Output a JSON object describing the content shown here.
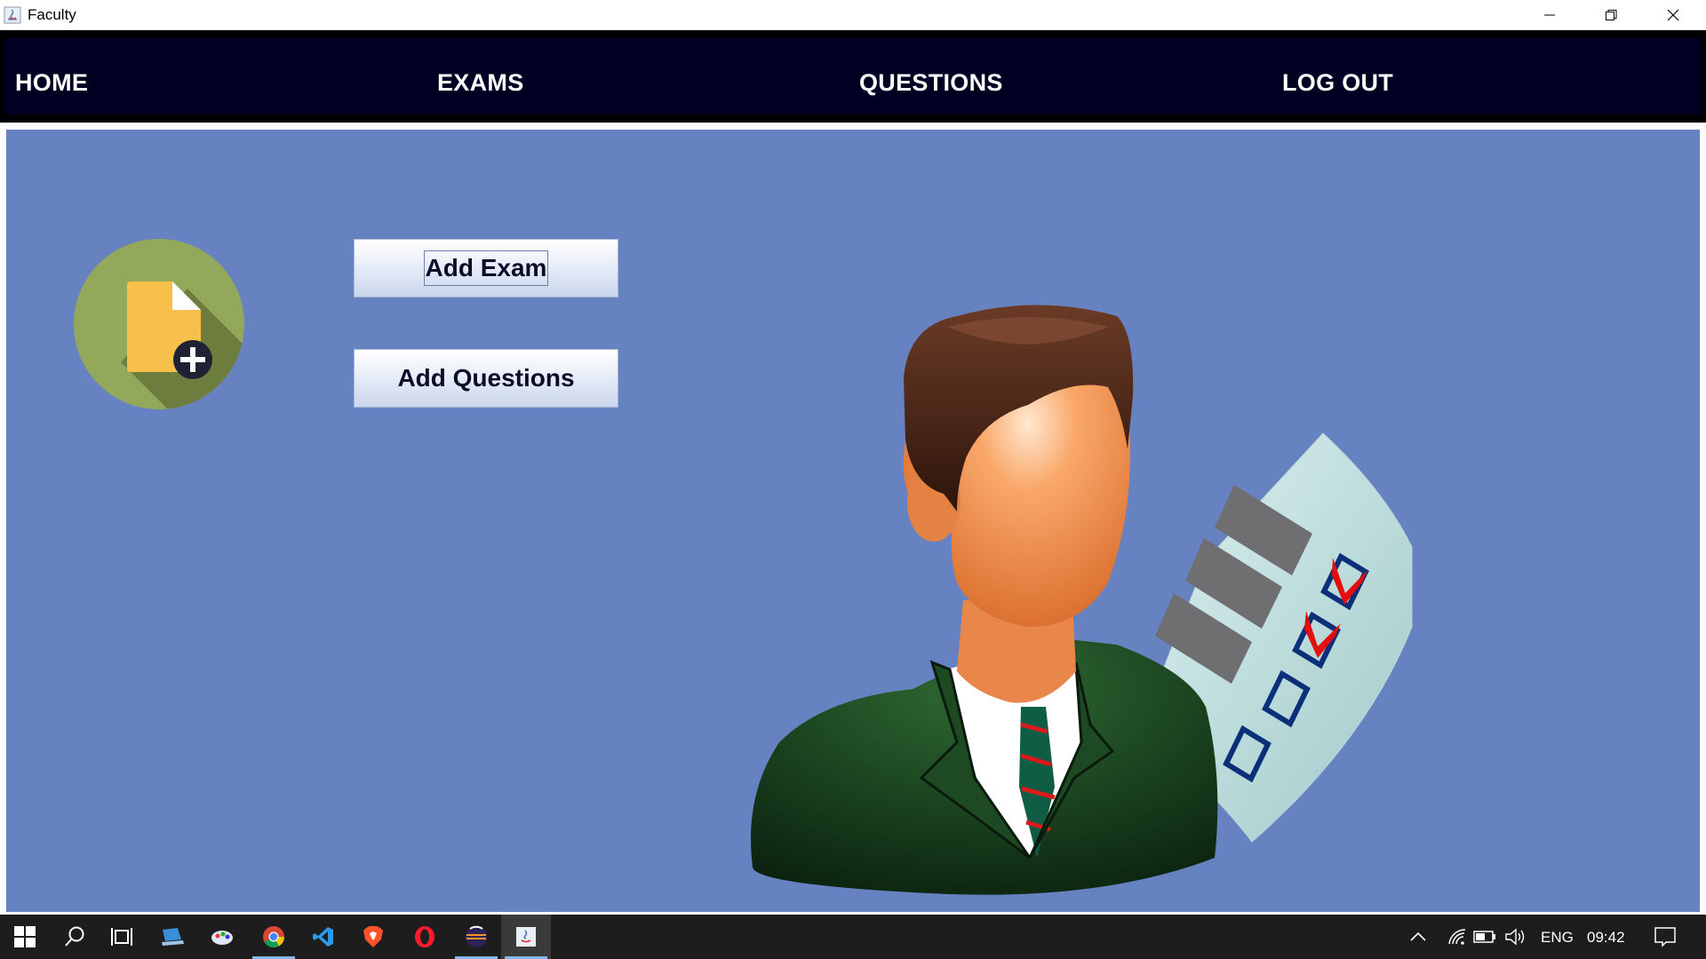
{
  "window": {
    "title": "Faculty"
  },
  "nav": {
    "home": "HOME",
    "exams": "EXAMS",
    "questions": "QUESTIONS",
    "logout": "LOG OUT"
  },
  "actions": {
    "add_exam": "Add Exam",
    "add_questions": "Add Questions"
  },
  "taskbar": {
    "apps": [
      "windows-start-icon",
      "search-icon",
      "task-view-icon",
      "app-laptop-icon",
      "app-paint-icon",
      "chrome-icon",
      "vscode-icon",
      "brave-icon",
      "opera-icon",
      "eclipse-icon",
      "java-app-icon"
    ],
    "language": "ENG",
    "time": "09:42"
  },
  "colors": {
    "nav_bg": "#000022",
    "main_bg": "#6782c1",
    "taskbar_bg": "#1d1d1d"
  }
}
